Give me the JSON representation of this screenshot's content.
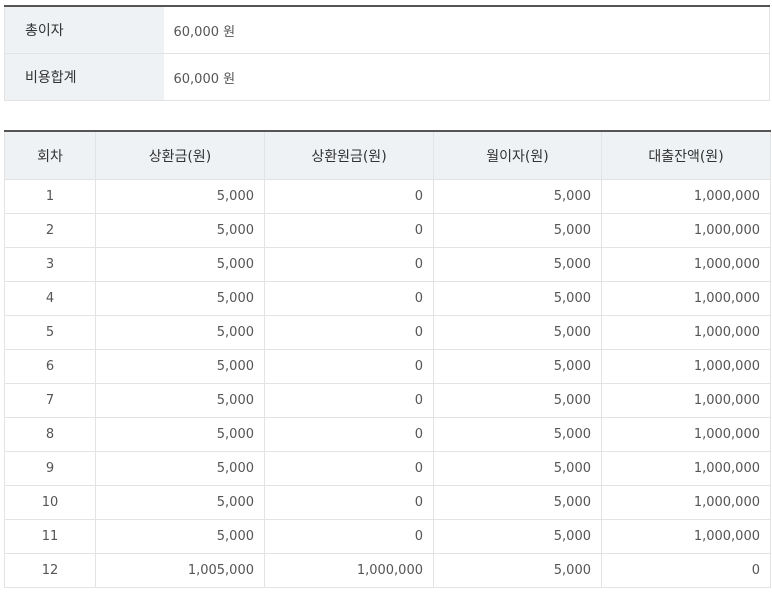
{
  "summary": [
    {
      "label": "총이자",
      "value": "60,000 원"
    },
    {
      "label": "비용합계",
      "value": "60,000 원"
    }
  ],
  "schedule": {
    "headers": [
      "회차",
      "상환금(원)",
      "상환원금(원)",
      "월이자(원)",
      "대출잔액(원)"
    ],
    "rows": [
      [
        "1",
        "5,000",
        "0",
        "5,000",
        "1,000,000"
      ],
      [
        "2",
        "5,000",
        "0",
        "5,000",
        "1,000,000"
      ],
      [
        "3",
        "5,000",
        "0",
        "5,000",
        "1,000,000"
      ],
      [
        "4",
        "5,000",
        "0",
        "5,000",
        "1,000,000"
      ],
      [
        "5",
        "5,000",
        "0",
        "5,000",
        "1,000,000"
      ],
      [
        "6",
        "5,000",
        "0",
        "5,000",
        "1,000,000"
      ],
      [
        "7",
        "5,000",
        "0",
        "5,000",
        "1,000,000"
      ],
      [
        "8",
        "5,000",
        "0",
        "5,000",
        "1,000,000"
      ],
      [
        "9",
        "5,000",
        "0",
        "5,000",
        "1,000,000"
      ],
      [
        "10",
        "5,000",
        "0",
        "5,000",
        "1,000,000"
      ],
      [
        "11",
        "5,000",
        "0",
        "5,000",
        "1,000,000"
      ],
      [
        "12",
        "1,005,000",
        "1,000,000",
        "5,000",
        "0"
      ]
    ]
  }
}
